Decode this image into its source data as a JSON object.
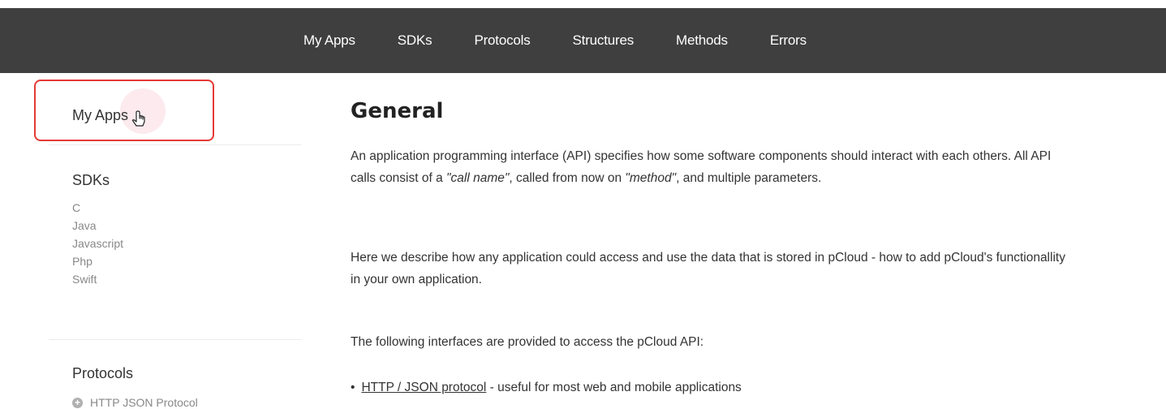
{
  "nav": {
    "items": [
      "My Apps",
      "SDKs",
      "Protocols",
      "Structures",
      "Methods",
      "Errors"
    ]
  },
  "sidebar": {
    "my_apps": "My Apps",
    "sdks": {
      "title": "SDKs",
      "items": [
        "C",
        "Java",
        "Javascript",
        "Php",
        "Swift"
      ]
    },
    "protocols": {
      "title": "Protocols",
      "items": [
        "HTTP JSON Protocol"
      ]
    }
  },
  "main": {
    "title": "General",
    "p1_a": "An application programming interface (API) specifies how some software components should interact with each others. All API calls consist of a ",
    "p1_em1": "\"call name\"",
    "p1_b": ", called from now on ",
    "p1_em2": "\"method\"",
    "p1_c": ", and multiple parameters.",
    "p2": "Here we describe how any application could access and use the data that is stored in pCloud - how to add pCloud's functionallity in your own application.",
    "p3": "The following interfaces are provided to access the pCloud API:",
    "bullet1_link": "HTTP / JSON protocol",
    "bullet1_text": " - useful for most web and mobile applications"
  },
  "colors": {
    "topbar": "#3f3f3f",
    "highlight_box": "#e53935"
  }
}
